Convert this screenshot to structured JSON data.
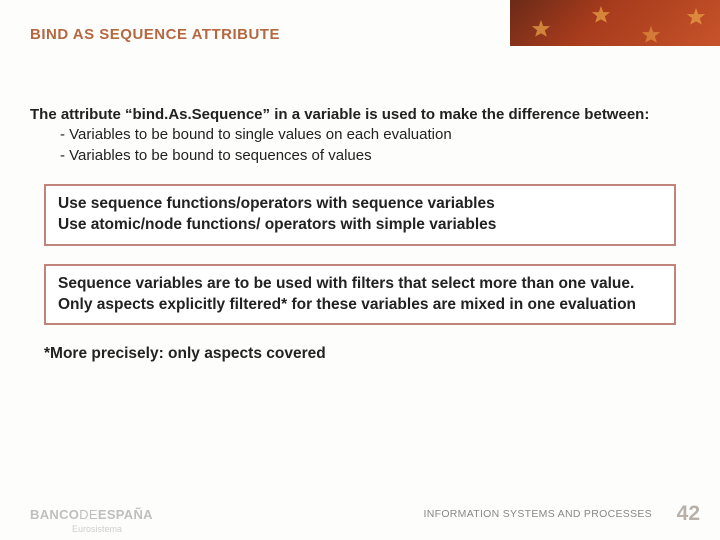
{
  "header": {
    "title": "BIND AS SEQUENCE ATTRIBUTE"
  },
  "intro": {
    "lead": "The attribute “bind.As.Sequence” in a variable is used to make the difference between:",
    "bullet1": "- Variables to be bound to single values on each evaluation",
    "bullet2": "- Variables to be bound to sequences of values"
  },
  "callout1": {
    "line1": "Use sequence functions/operators with sequence variables",
    "line2": "Use atomic/node functions/ operators with simple variables"
  },
  "callout2": {
    "text": "Sequence variables are to be used with filters that select more than one value. Only aspects explicitly filtered*  for these variables are mixed in one evaluation"
  },
  "footnote": "*More precisely: only aspects covered",
  "footer": {
    "logo_part1": "BANCO",
    "logo_part2": "DE",
    "logo_part3": "ESPAÑA",
    "logo_sub": "Eurosistema",
    "department": "INFORMATION SYSTEMS AND PROCESSES",
    "page": "42"
  }
}
